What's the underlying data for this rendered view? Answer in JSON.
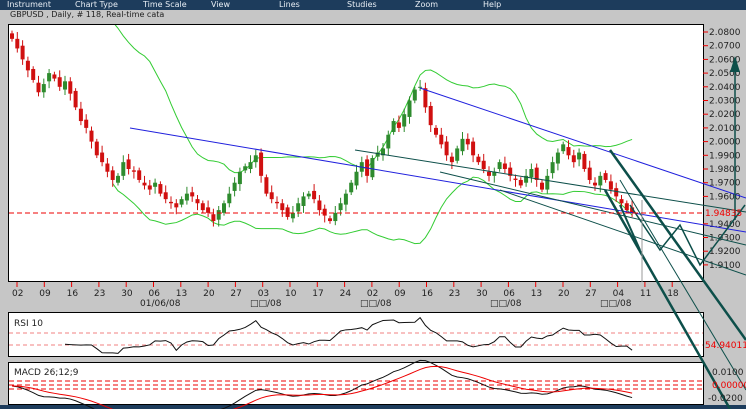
{
  "menu": [
    "Instrument",
    "Chart Type",
    "Time Scale",
    "View",
    "Lines",
    "Studies",
    "Zoom",
    "Help"
  ],
  "title": "GBPUSD , Daily, # 118, Real-time cata",
  "price_axis": [
    "2.0800",
    "2.0700",
    "2.0600",
    "2.0500",
    "2.0400",
    "2.0300",
    "2.0200",
    "2.0100",
    "2.0000",
    "1.9900",
    "1.9800",
    "1.9700",
    "1.9600",
    "1.9400",
    "1.9300",
    "1.9200",
    "1.9100"
  ],
  "current_price": "1.94835",
  "date_ticks": [
    "02",
    "09",
    "16",
    "23",
    "30",
    "06",
    "13",
    "20",
    "27",
    "03",
    "10",
    "17",
    "24",
    "02",
    "09",
    "16",
    "23",
    "30",
    "06",
    "13",
    "20",
    "27",
    "04",
    "11",
    "18"
  ],
  "month_labels": [
    "01/06/08",
    "□□/08",
    "□□/08",
    "□□/08",
    "□□/08"
  ],
  "rsi": {
    "label": "RSI 10",
    "value": "54.94011"
  },
  "macd": {
    "label": "MACD 26;12;9",
    "ticks": [
      "0.0100",
      "-0.0200"
    ],
    "value": "0.00000"
  },
  "colors": {
    "up": "#2e8b2e",
    "down": "#d01010",
    "band": "#33cc33",
    "trend": "#2020dd",
    "channel": "#0d4f4a",
    "current": "#e00000"
  },
  "chart_data": {
    "type": "candlestick",
    "symbol": "GBPUSD",
    "bars": 118,
    "ylim": [
      1.905,
      2.085
    ],
    "closes": [
      2.075,
      2.068,
      2.06,
      2.052,
      2.045,
      2.036,
      2.042,
      2.05,
      2.046,
      2.04,
      2.044,
      2.035,
      2.025,
      2.015,
      2.01,
      2.0,
      1.99,
      1.985,
      1.978,
      1.972,
      1.975,
      1.985,
      1.98,
      1.978,
      1.972,
      1.968,
      1.965,
      1.97,
      1.962,
      1.958,
      1.955,
      1.952,
      1.958,
      1.962,
      1.96,
      1.955,
      1.95,
      1.948,
      1.942,
      1.95,
      1.955,
      1.962,
      1.97,
      1.978,
      1.982,
      1.985,
      1.99,
      1.975,
      1.962,
      1.958,
      1.955,
      1.95,
      1.945,
      1.948,
      1.955,
      1.96,
      1.962,
      1.958,
      1.95,
      1.946,
      1.942,
      1.948,
      1.955,
      1.962,
      1.97,
      1.978,
      1.985,
      1.975,
      1.988,
      1.992,
      1.995,
      2.005,
      2.015,
      2.01,
      2.02,
      2.03,
      2.038,
      2.04,
      2.025,
      2.012,
      2.005,
      1.998,
      1.99,
      1.985,
      1.995,
      2.002,
      1.998,
      1.99,
      1.985,
      1.98,
      1.975,
      1.978,
      1.985,
      1.98,
      1.975,
      1.972,
      1.968,
      1.975,
      1.98,
      1.972,
      1.965,
      1.975,
      1.985,
      1.992,
      1.998,
      1.99,
      1.985,
      1.992,
      1.98,
      1.972,
      1.968,
      1.975,
      1.972,
      1.965,
      1.96,
      1.955,
      1.95,
      1.948
    ]
  }
}
